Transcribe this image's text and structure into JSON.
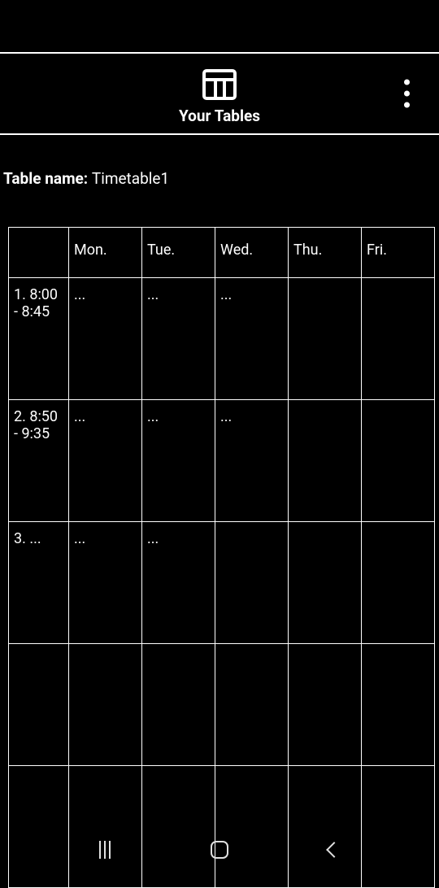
{
  "header": {
    "title": "Your Tables"
  },
  "table_name": {
    "label": "Table name: ",
    "value": "Timetable1"
  },
  "timetable": {
    "headers": [
      "",
      "Mon.",
      "Tue.",
      "Wed.",
      "Thu.",
      "Fri."
    ],
    "rows": [
      {
        "time": "1. 8:00 - 8:45",
        "cells": [
          "...",
          "...",
          "...",
          "",
          ""
        ]
      },
      {
        "time": "2. 8:50 - 9:35",
        "cells": [
          "...",
          "...",
          "...",
          "",
          ""
        ]
      },
      {
        "time": "3. ...",
        "cells": [
          "...",
          "...",
          "",
          "",
          ""
        ]
      },
      {
        "time": "",
        "cells": [
          "",
          "",
          "",
          "",
          ""
        ]
      },
      {
        "time": "",
        "cells": [
          "",
          "",
          "",
          "",
          ""
        ]
      }
    ]
  }
}
